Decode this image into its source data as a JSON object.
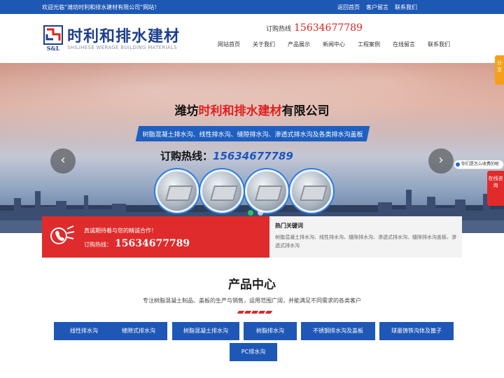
{
  "topbar": {
    "welcome": "欢迎光临“潍坊时利和排水建材有限公司”网站！",
    "links": [
      "返回首页",
      "客户留言",
      "联系我们"
    ]
  },
  "header": {
    "logo_mark_text": "S&L",
    "logo_cn": "时利和排水建材",
    "logo_en": "SHILIHESE WERAGE BUILDING MATERIALS",
    "hotline_label": "订购热线",
    "hotline_number": "15634677789",
    "nav": [
      "网站首页",
      "关于我们",
      "产品展示",
      "新闻中心",
      "工程案例",
      "在线留言",
      "联系我们"
    ]
  },
  "banner": {
    "title_prefix": "潍坊",
    "title_highlight": "时利和排水建材",
    "title_suffix": "有限公司",
    "strip_text": "树脂混凝土排水沟、线性排水沟、缝隙排水沟、渗透式排水沟及各类排水沟盖板",
    "phone_label": "订购热线：",
    "phone_number": "15634677789",
    "prev_icon": "chevron-left-icon",
    "next_icon": "chevron-right-icon",
    "slide_count": 2,
    "active_slide": 1
  },
  "floats": {
    "share_label": "分享",
    "qq_text": "你们是怎么收费的呢",
    "online_label": "在线咨询"
  },
  "info": {
    "greeting": "真诚期待着与您的精诚合作！",
    "hotline_label": "订购热线：",
    "hotline_number": "15634677789",
    "keywords_title": "热门关键词",
    "keywords": "树脂混凝土排水沟、线性排水沟、缝隙排水沟、渗透式排水沟、缝隙排水沟盖板、渗透式排水沟"
  },
  "products_section": {
    "title": "产品中心",
    "subtitle": "专注树脂混凝土制品、盖板的生产与销售，运用范围广阔，并能满足不同需求的各类客户",
    "categories": [
      "线性排水沟",
      "缝隙式排水沟",
      "树脂混凝土排水沟",
      "树脂排水沟",
      "不锈钢排水沟及盖板",
      "球墨铸铁沟体及篦子",
      "PC排水沟"
    ]
  },
  "colors": {
    "brand_blue": "#1e58b5",
    "accent_red": "#df2b2b",
    "dot_active": "#24c75f"
  }
}
